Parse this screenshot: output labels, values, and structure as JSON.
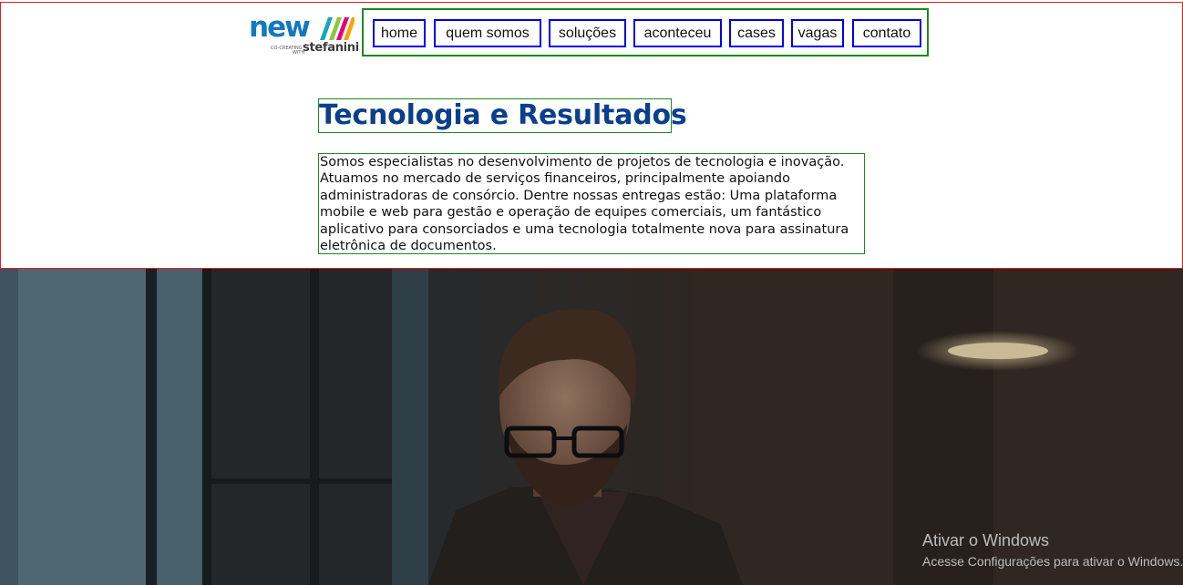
{
  "brand": {
    "logo_word": "new",
    "logo_tag_line1": "CO-CREATING",
    "logo_tag_line2": "WITH",
    "logo_partner": "stefanini",
    "logo_stripe_colors": [
      "#1aa6b7",
      "#8cc63f",
      "#e5007e",
      "#f7a600"
    ],
    "primary_color": "#1279bd"
  },
  "nav": {
    "items": [
      {
        "label": "home"
      },
      {
        "label": "quem somos"
      },
      {
        "label": "soluções"
      },
      {
        "label": "aconteceu"
      },
      {
        "label": "cases"
      },
      {
        "label": "vagas"
      },
      {
        "label": "contato"
      }
    ]
  },
  "intro": {
    "title": "Tecnologia e Resultados",
    "body": "Somos especialistas no desenvolvimento de projetos de tecnologia e inovação. Atuamos no mercado de serviços financeiros, principalmente apoiando administradoras de consórcio. Dentre nossas entregas estão: Uma plataforma mobile e web para gestão e operação de equipes comerciais, um fantástico aplicativo para consorciados e uma tecnologia totalmente nova para assinatura eletrônica de documentos."
  },
  "windows_activation": {
    "title": "Ativar o Windows",
    "subtitle": "Acesse Configurações para ativar o Windows."
  },
  "colors": {
    "title_blue": "#0b3f8c",
    "section_border_red": "#e21d1d",
    "box_border_green": "#1d8a1d",
    "nav_border_blue": "#0000e6"
  }
}
